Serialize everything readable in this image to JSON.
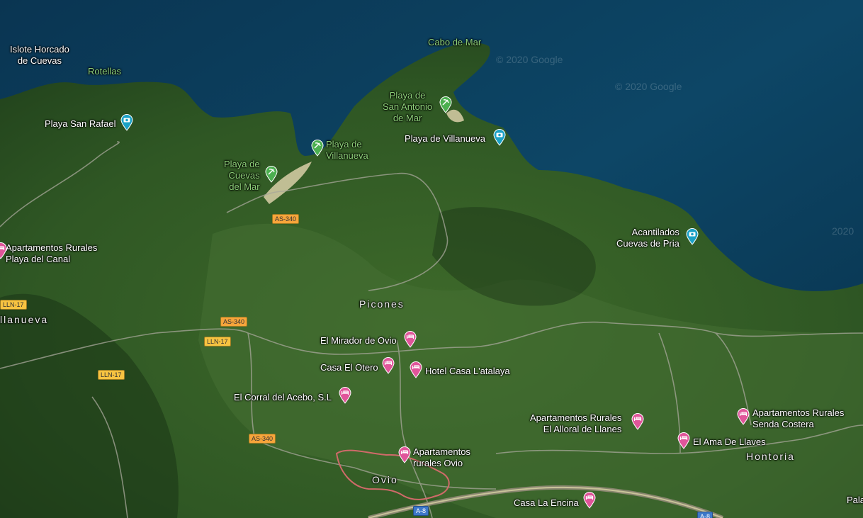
{
  "watermarks": [
    "© 2020 Google",
    "© 2020 Google",
    "2020"
  ],
  "labels": {
    "islote": "Islote Horcado\nde Cuevas",
    "rotellas": "Rotellas",
    "cabo_mar": "Cabo de Mar",
    "playa_san_rafael": "Playa San Rafael",
    "playa_san_antonio": "Playa de\nSan Antonio\nde Mar",
    "playa_villanueva_green": "Playa de\nVillanueva",
    "playa_villanueva_blue": "Playa de Villanueva",
    "playa_cuevas": "Playa de\nCuevas\ndel Mar",
    "acantilados": "Acantilados\nCuevas de Pria",
    "ap_playa_canal": "Apartamentos Rurales\nPlaya del Canal",
    "villanueva": "llanueva",
    "picones": "Picones",
    "mirador": "El Mirador de Ovio",
    "casa_otero": "Casa El Otero",
    "hotel_atalaya": "Hotel Casa L'atalaya",
    "corral_acebo": "El Corral del Acebo, S.L",
    "ap_ovio": "Apartamentos\nrurales Ovio",
    "ovio": "Ovio",
    "ap_alloral": "Apartamentos Rurales\nEl Alloral de Llanes",
    "ap_senda": "Apartamentos Rurales\nSenda Costera",
    "ama_llaves": "El Ama De Llaves",
    "hontoria": "Hontoria",
    "casa_encina": "Casa La Encina",
    "pala": "Pala"
  },
  "shields": {
    "as340_a": "AS-340",
    "as340_b": "AS-340",
    "as340_c": "AS-340",
    "lln17_a": "LLN-17",
    "lln17_b": "LLN-17",
    "lln17_c": "LLN-17",
    "a8_a": "A-8",
    "a8_b": "A-8"
  },
  "icons": {
    "green_pin": "beach-pin-icon",
    "cyan_pin": "camera-pin-icon",
    "pink_pin": "lodging-pin-icon"
  },
  "colors": {
    "sea": "#0c3a52",
    "land": "#2e5a26",
    "green_pin": "#4caf50",
    "cyan_pin": "#1ba1c6",
    "pink_pin": "#e0559a",
    "boundary": "#d06a6a"
  }
}
